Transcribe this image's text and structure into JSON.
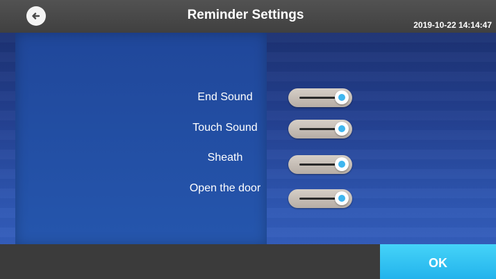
{
  "header": {
    "title": "Reminder Settings",
    "datetime": "2019-10-22 14:14:47",
    "back_icon": "back-arrow-icon"
  },
  "settings": [
    {
      "label": "End Sound",
      "enabled": true
    },
    {
      "label": "Touch Sound",
      "enabled": true
    },
    {
      "label": "Sheath",
      "enabled": true
    },
    {
      "label": "Open the door",
      "enabled": true
    }
  ],
  "footer": {
    "ok_label": "OK"
  },
  "colors": {
    "header_bg": "#4a4a4a",
    "panel_bg": "#2556ad",
    "toggle_accent": "#3fb6ef",
    "ok_bg": "#2fc0f0"
  }
}
